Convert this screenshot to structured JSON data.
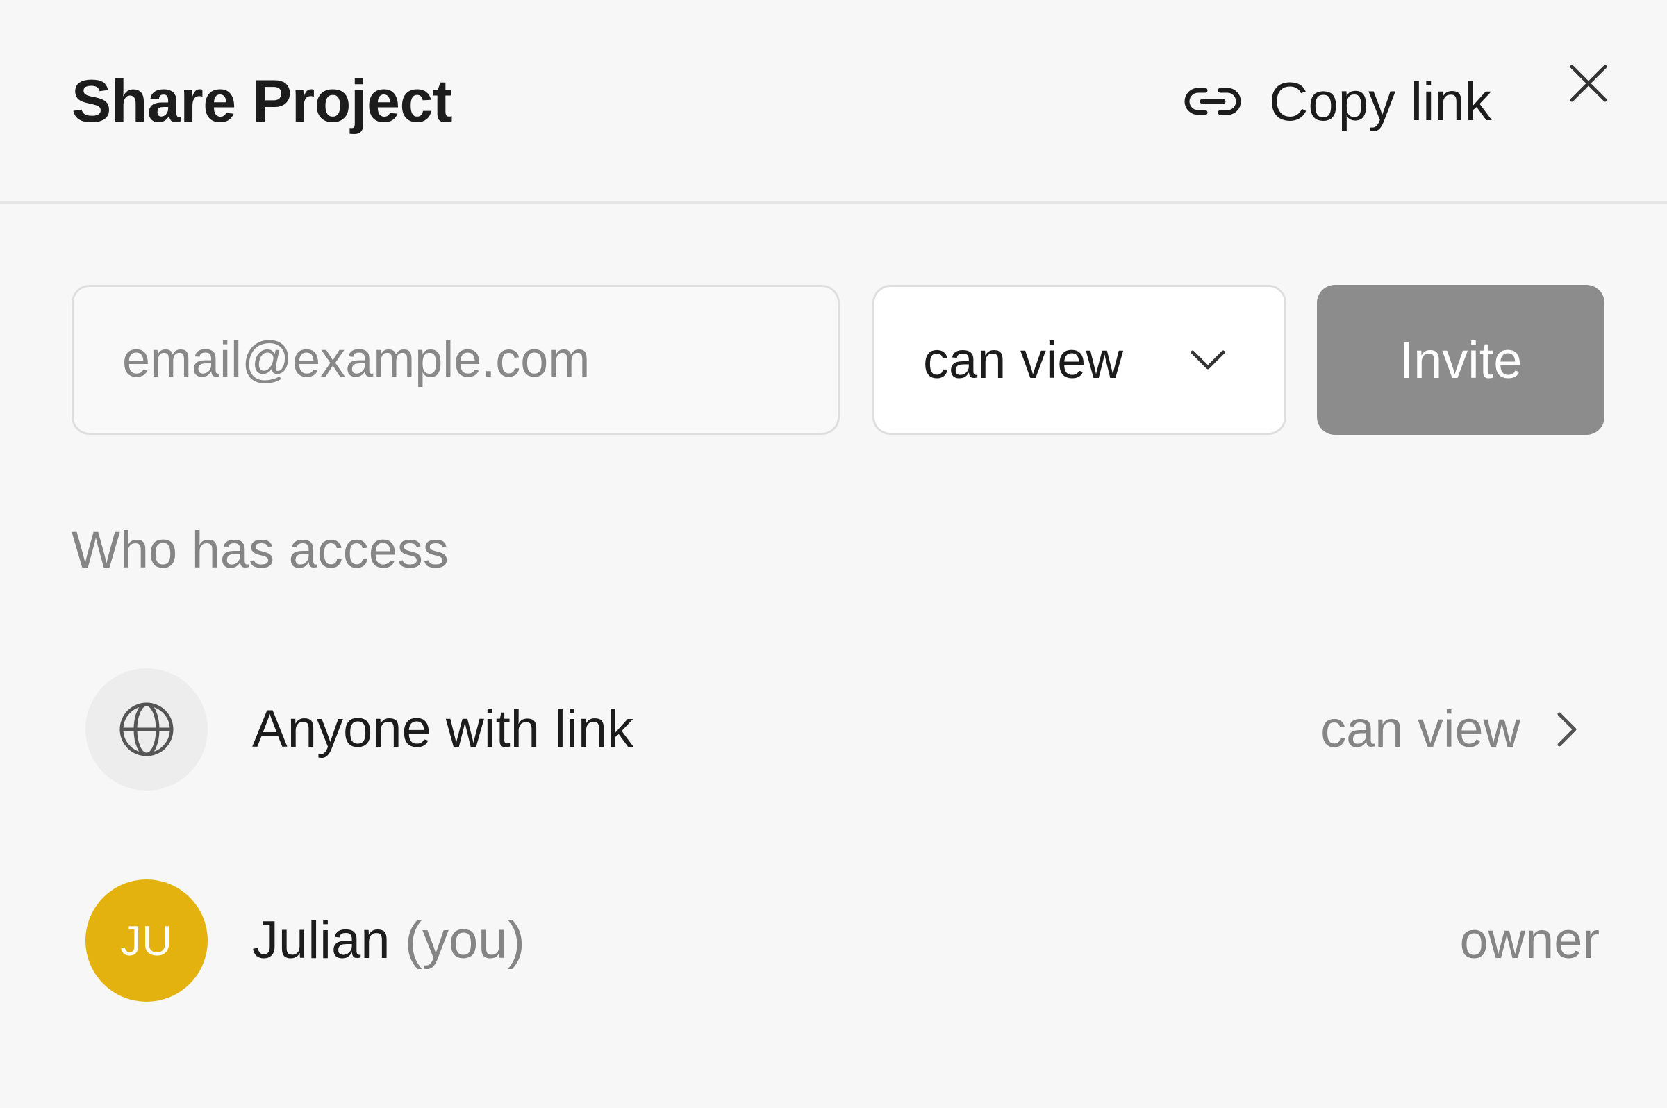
{
  "dialog": {
    "title": "Share Project",
    "copy_link_label": "Copy link"
  },
  "invite": {
    "email_placeholder": "email@example.com",
    "email_value": "",
    "role_value": "can view",
    "invite_label": "Invite"
  },
  "access": {
    "section_label": "Who has access",
    "entries": [
      {
        "name": "Anyone with link",
        "suffix": "",
        "permission": "can view",
        "icon": "globe-icon"
      },
      {
        "name": "Julian",
        "suffix": "(you)",
        "initials": "JU",
        "permission": "owner",
        "avatar_color": "#e4b20f"
      }
    ]
  },
  "colors": {
    "background": "#f7f7f7",
    "invite_button_disabled": "#8c8c8c",
    "avatar_julian": "#e4b20f",
    "muted_text": "#858585"
  }
}
